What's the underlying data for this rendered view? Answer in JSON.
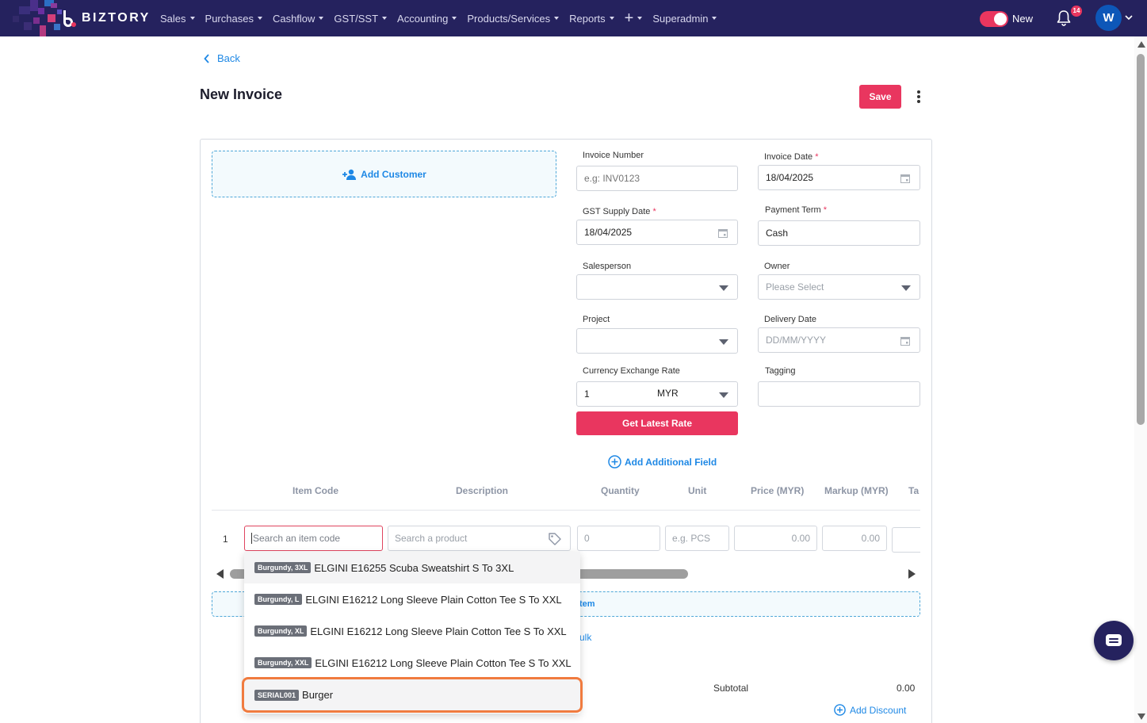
{
  "brand": {
    "name": "BIZTORY"
  },
  "nav": {
    "items": [
      {
        "label": "Sales",
        "icon": "chevron-down-icon"
      },
      {
        "label": "Purchases",
        "icon": "chevron-down-icon"
      },
      {
        "label": "Cashflow",
        "icon": "chevron-down-icon"
      },
      {
        "label": "GST/SST",
        "icon": "chevron-down-icon"
      },
      {
        "label": "Accounting",
        "icon": "chevron-down-icon"
      },
      {
        "label": "Products/Services",
        "icon": "chevron-down-icon"
      },
      {
        "label": "Reports",
        "icon": "chevron-down-icon"
      }
    ],
    "plus_icon": "plus-icon",
    "user_menu": "Superadmin",
    "toggle_label": "New",
    "notification_count": "14",
    "avatar_initial": "W"
  },
  "page": {
    "back_label": "Back",
    "title": "New Invoice",
    "save_label": "Save"
  },
  "form": {
    "add_customer": "Add Customer",
    "invoice_number": {
      "label": "Invoice Number",
      "placeholder": "e.g: INV0123"
    },
    "invoice_date": {
      "label": "Invoice Date",
      "value": "18/04/2025",
      "required": "*"
    },
    "gst_supply_date": {
      "label": "GST Supply Date",
      "value": "18/04/2025",
      "required": "*"
    },
    "payment_term": {
      "label": "Payment Term",
      "value": "Cash",
      "required": "*"
    },
    "salesperson": {
      "label": "Salesperson",
      "value": ""
    },
    "owner": {
      "label": "Owner",
      "placeholder": "Please Select"
    },
    "project": {
      "label": "Project",
      "value": ""
    },
    "delivery_date": {
      "label": "Delivery Date",
      "placeholder": "DD/MM/YYYY"
    },
    "currency_exchange_rate": {
      "label": "Currency Exchange Rate",
      "rate": "1",
      "currency": "MYR"
    },
    "tagging": {
      "label": "Tagging",
      "value": ""
    },
    "get_latest_rate": "Get Latest Rate",
    "add_additional_field": "Add Additional Field"
  },
  "items_table": {
    "columns": [
      "Item Code",
      "Description",
      "Quantity",
      "Unit",
      "Price (MYR)",
      "Markup (MYR)",
      "Ta"
    ],
    "row": {
      "number": "1",
      "item_code_placeholder": "Search an item code",
      "description_placeholder": "Search a product",
      "quantity_placeholder": "0",
      "unit_placeholder": "e.g. PCS",
      "price_placeholder": "0.00",
      "markup_placeholder": "0.00"
    },
    "add_item_partial": "tem",
    "bulk_partial": "ulk"
  },
  "dropdown": {
    "options": [
      {
        "chip": "Burgundy, 3XL",
        "label": "ELGINI E16255 Scuba Sweatshirt S To 3XL"
      },
      {
        "chip": "Burgundy, L",
        "label": "ELGINI E16212 Long Sleeve Plain Cotton Tee S To XXL"
      },
      {
        "chip": "Burgundy, XL",
        "label": "ELGINI E16212 Long Sleeve Plain Cotton Tee S To XXL"
      },
      {
        "chip": "Burgundy, XXL",
        "label": "ELGINI E16212 Long Sleeve Plain Cotton Tee S To XXL"
      },
      {
        "chip": "SERIAL001",
        "label": "Burger"
      }
    ]
  },
  "totals": {
    "subtotal_label": "Subtotal",
    "subtotal_value": "0.00",
    "add_discount": "Add Discount"
  },
  "colors": {
    "nav_bg": "#25225e",
    "accent": "#e9365f",
    "link": "#1e88e5",
    "highlight": "#f07b3f"
  }
}
